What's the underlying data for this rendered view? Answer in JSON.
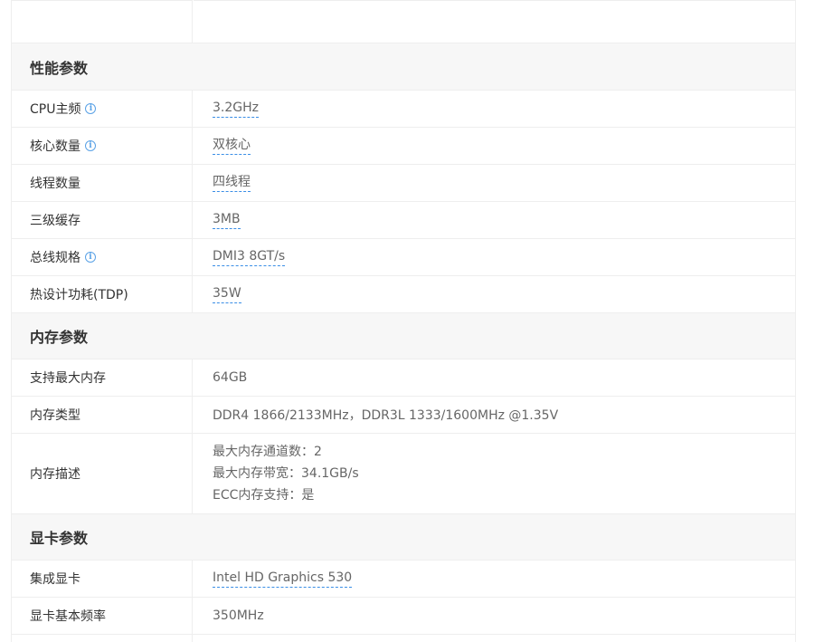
{
  "sections": {
    "performance": {
      "title": "性能参数",
      "rows": [
        {
          "label": "CPU主频",
          "value": "3.2GHz"
        },
        {
          "label": "核心数量",
          "value": "双核心"
        },
        {
          "label": "线程数量",
          "value": "四线程"
        },
        {
          "label": "三级缓存",
          "value": "3MB"
        },
        {
          "label": "总线规格",
          "value": "DMI3 8GT/s"
        },
        {
          "label": "热设计功耗(TDP)",
          "value": "35W"
        }
      ]
    },
    "memory": {
      "title": "内存参数",
      "rows": [
        {
          "label": "支持最大内存",
          "value": "64GB"
        },
        {
          "label": "内存类型",
          "value": "DDR4 1866/2133MHz，DDR3L 1333/1600MHz @1.35V"
        },
        {
          "label": "内存描述",
          "lines": [
            "最大内存通道数：2",
            "最大内存带宽：34.1GB/s",
            "ECC内存支持：是"
          ]
        }
      ]
    },
    "graphics": {
      "title": "显卡参数",
      "rows": [
        {
          "label": "集成显卡",
          "value": "Intel HD Graphics 530"
        },
        {
          "label": "显卡基本频率",
          "value": "350MHz"
        }
      ]
    }
  },
  "icons": {
    "info": "info-circle-icon",
    "info_glyph": "i"
  },
  "colors": {
    "link_underline": "#3a8ee6",
    "section_bg": "#f7f7f7",
    "border": "#eeeeee"
  }
}
